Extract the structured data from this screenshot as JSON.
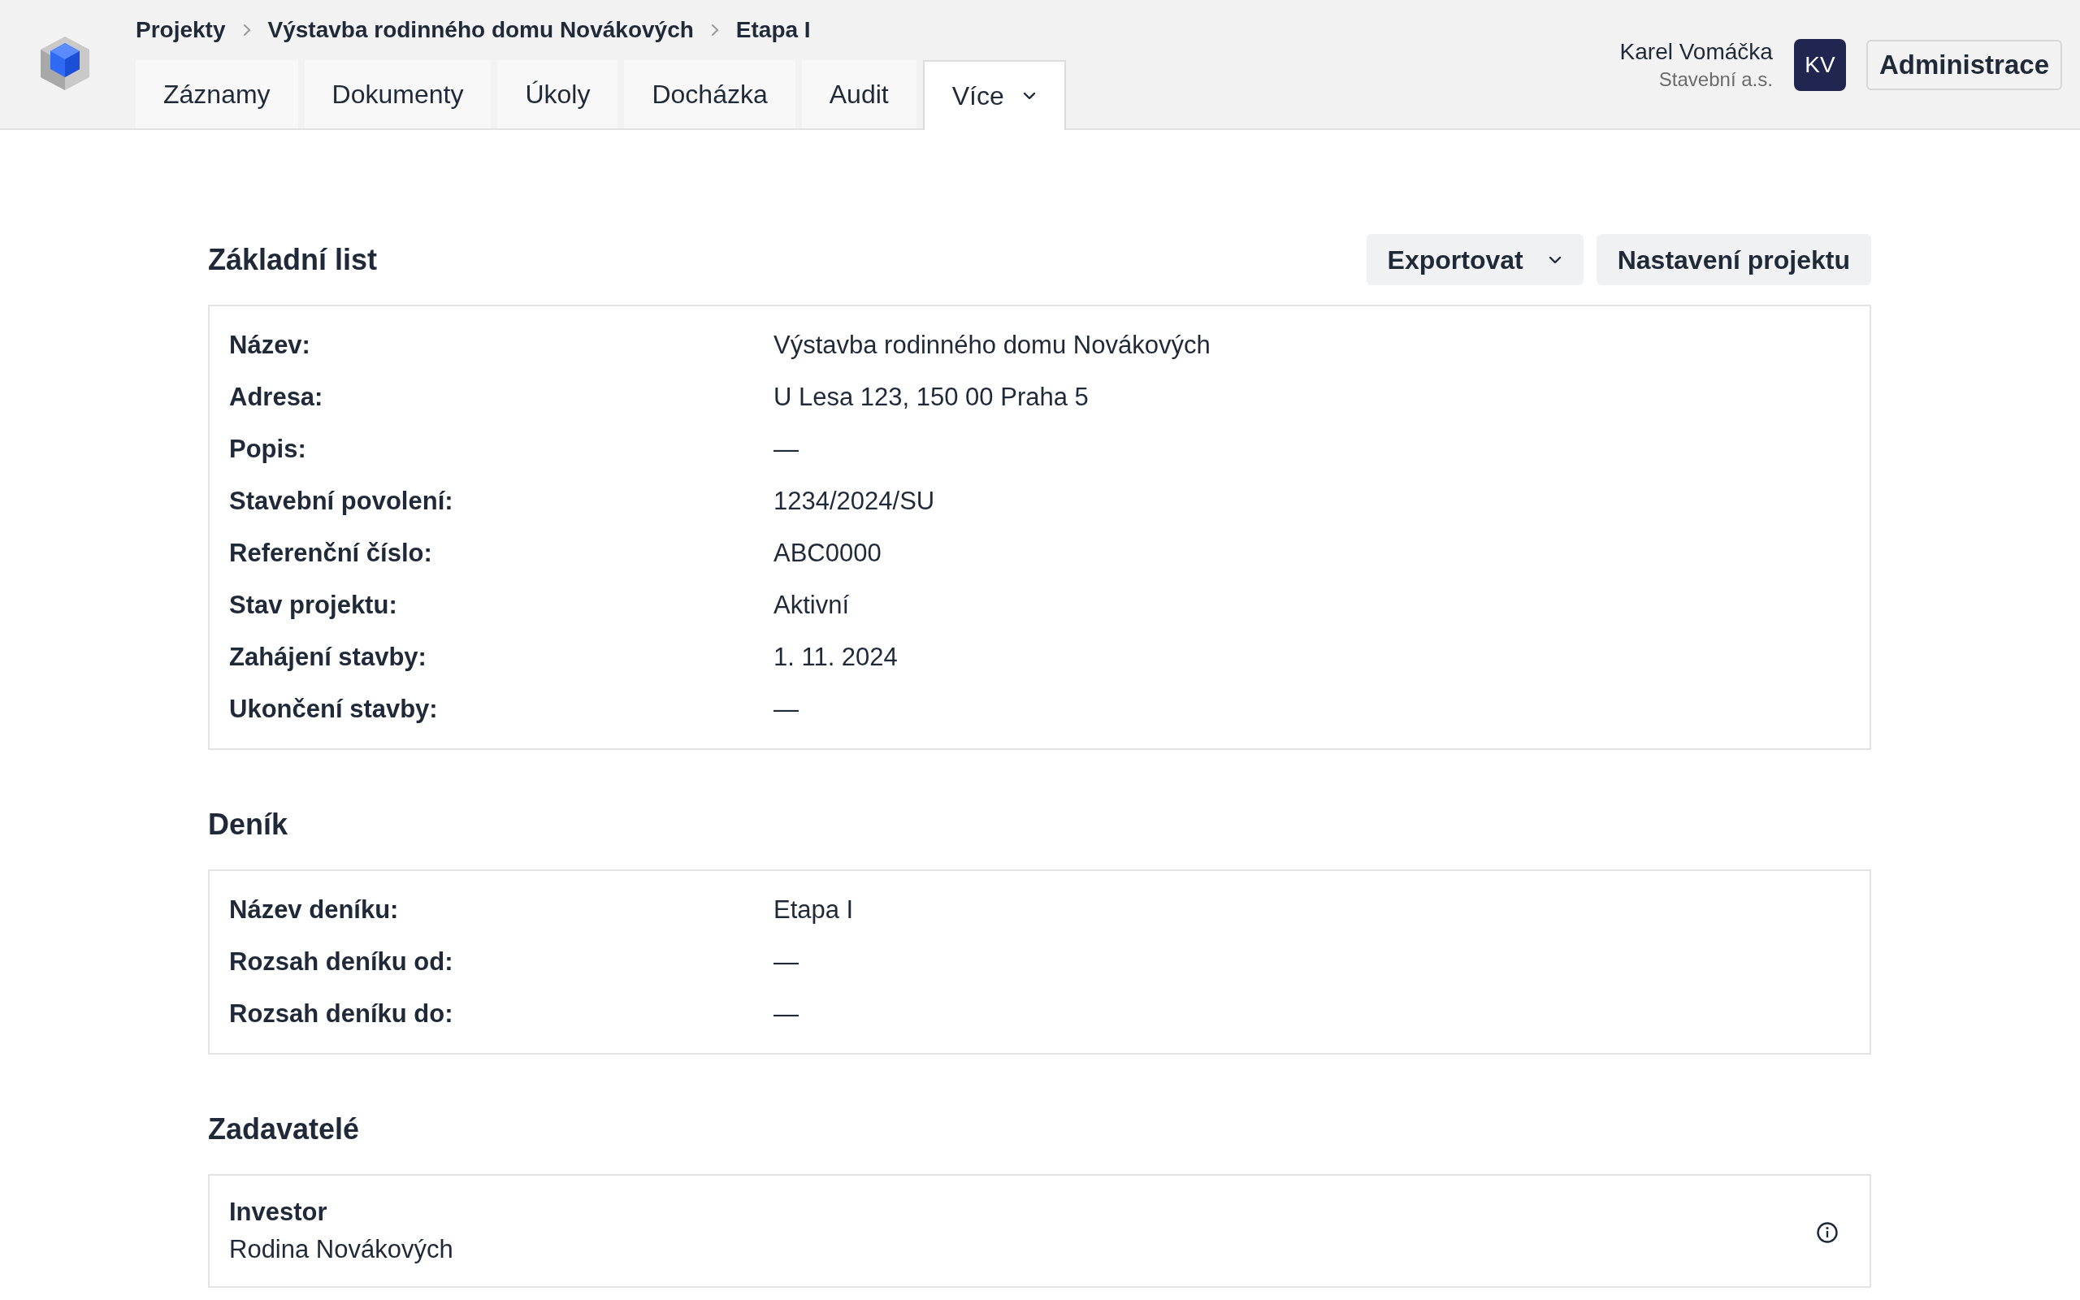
{
  "breadcrumb": [
    "Projekty",
    "Výstavba rodinného domu Novákových",
    "Etapa I"
  ],
  "tabs": [
    {
      "label": "Záznamy",
      "selected": false,
      "kind": "link"
    },
    {
      "label": "Dokumenty",
      "selected": false,
      "kind": "link"
    },
    {
      "label": "Úkoly",
      "selected": false,
      "kind": "link"
    },
    {
      "label": "Docházka",
      "selected": false,
      "kind": "link"
    },
    {
      "label": "Audit",
      "selected": false,
      "kind": "link"
    },
    {
      "label": "Více",
      "selected": true,
      "kind": "menu"
    }
  ],
  "user": {
    "name": "Karel Vomáčka",
    "company": "Stavební a.s.",
    "initials": "KV"
  },
  "admin_button": "Administrace",
  "sections": [
    {
      "title": "Základní list",
      "kind": "fields",
      "actions": [
        {
          "label": "Exportovat",
          "kind": "menu"
        },
        {
          "label": "Nastavení projektu",
          "kind": "button"
        }
      ],
      "fields": [
        {
          "label": "Název:",
          "value": "Výstavba rodinného domu Novákových"
        },
        {
          "label": "Adresa:",
          "value": "U Lesa 123, 150 00 Praha 5"
        },
        {
          "label": "Popis:",
          "value": "—"
        },
        {
          "label": "Stavební povolení:",
          "value": "1234/2024/SU"
        },
        {
          "label": "Referenční číslo:",
          "value": "ABC0000"
        },
        {
          "label": "Stav projektu:",
          "value": "Aktivní"
        },
        {
          "label": "Zahájení stavby:",
          "value": "1. 11. 2024"
        },
        {
          "label": "Ukončení stavby:",
          "value": "—"
        }
      ]
    },
    {
      "title": "Deník",
      "kind": "fields",
      "fields": [
        {
          "label": "Název deníku:",
          "value": "Etapa I"
        },
        {
          "label": "Rozsah deníku od:",
          "value": "—"
        },
        {
          "label": "Rozsah deníku do:",
          "value": "—"
        }
      ]
    },
    {
      "title": "Zadavatelé",
      "kind": "parties",
      "parties": [
        {
          "role": "Investor",
          "name": "Rodina Novákových"
        }
      ]
    }
  ]
}
